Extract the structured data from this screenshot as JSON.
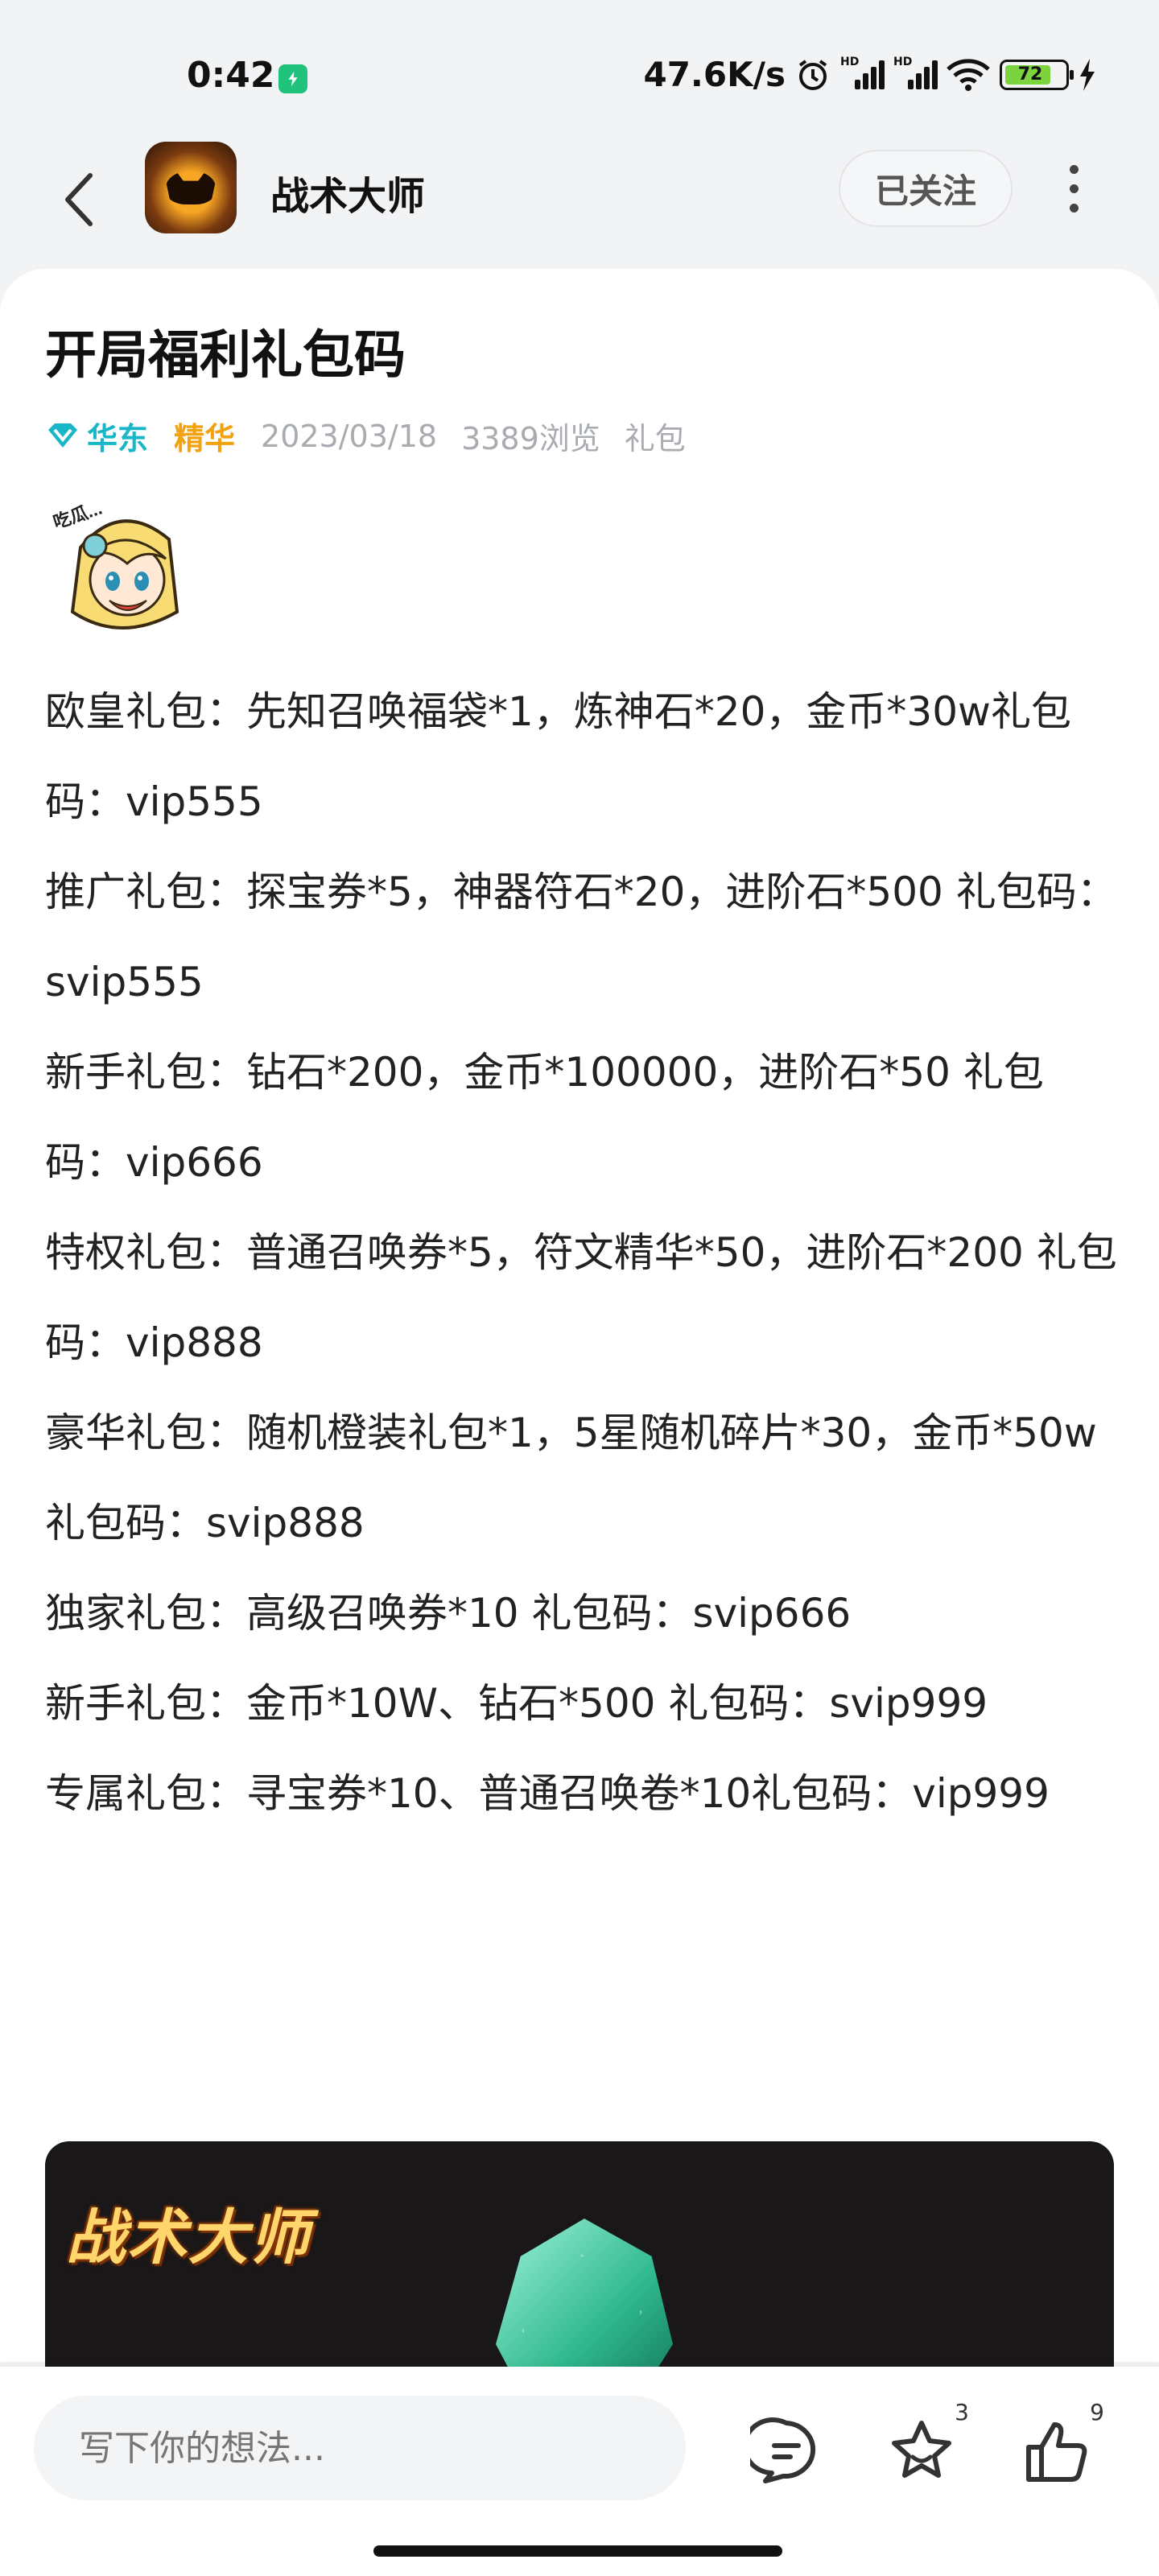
{
  "status_bar": {
    "time": "0:42",
    "network_speed": "47.6K/s",
    "battery": "72",
    "icons": [
      "vpn-icon",
      "alarm-icon",
      "hd-signal-icon",
      "hd-signal-icon",
      "wifi-icon",
      "battery-icon",
      "charging-icon"
    ]
  },
  "header": {
    "title": "战术大师",
    "follow_label": "已关注"
  },
  "post": {
    "title": "开局福利礼包码",
    "region": "华东",
    "tag": "精华",
    "date": "2023/03/18",
    "views": "3389浏览",
    "category": "礼包",
    "sticker_text": "吃瓜...",
    "paragraphs": [
      "欧皇礼包：先知召唤福袋*1，炼神石*20，金币*30w礼包码：vip555",
      "推广礼包：探宝券*5，神器符石*20，进阶石*500  礼包码：svip555",
      "新手礼包：钻石*200，金币*100000，进阶石*50 礼包码：vip666",
      "特权礼包：普通召唤券*5，符文精华*50，进阶石*200 礼包码：vip888",
      "豪华礼包：随机橙装礼包*1，5星随机碎片*30，金币*50w 礼包码：svip888",
      "独家礼包：高级召唤券*10 礼包码：svip666",
      "新手礼包：金币*10W、钻石*500 礼包码：svip999",
      "专属礼包：寻宝券*10、普通召唤卷*10礼包码：vip999"
    ]
  },
  "banner": {
    "title": "战术大师"
  },
  "bottom_bar": {
    "comment_placeholder": "写下你的想法...",
    "favorite_count": "3",
    "like_count": "9"
  },
  "colors": {
    "region": "#19b6c7",
    "essence": "#f2a20f",
    "meta_text": "#a8abb0"
  }
}
